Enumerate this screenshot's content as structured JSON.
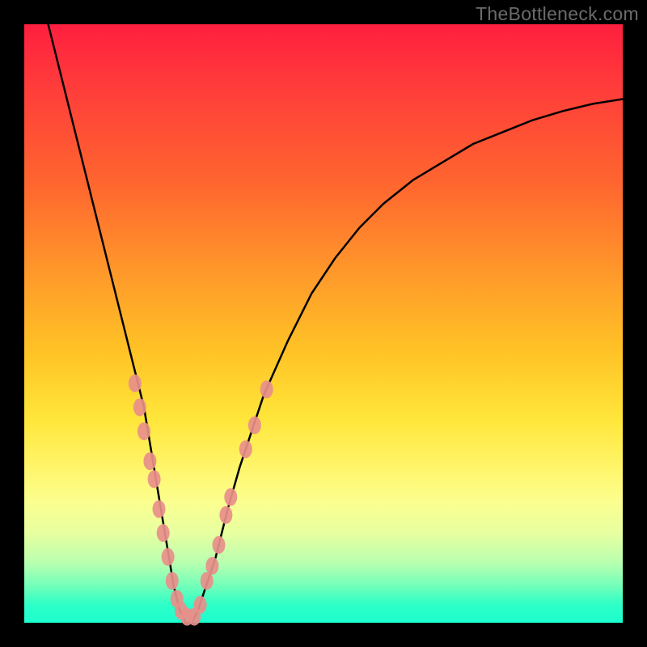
{
  "watermark": "TheBottleneck.com",
  "chart_data": {
    "type": "line",
    "title": "",
    "xlabel": "",
    "ylabel": "",
    "xlim": [
      0,
      100
    ],
    "ylim": [
      0,
      100
    ],
    "series": [
      {
        "name": "curve",
        "x": [
          4,
          6,
          8,
          10,
          12,
          14,
          16,
          18,
          20,
          22,
          23,
          24,
          25,
          26,
          27,
          28,
          29,
          30,
          32,
          34,
          36,
          38,
          40,
          44,
          48,
          52,
          56,
          60,
          65,
          70,
          75,
          80,
          85,
          90,
          95,
          100
        ],
        "y": [
          100,
          92,
          84,
          76,
          68,
          60,
          52,
          44,
          36,
          24,
          18,
          12,
          6,
          2,
          0,
          0,
          2,
          5,
          11,
          19,
          26,
          32,
          38,
          47,
          55,
          61,
          66,
          70,
          74,
          77,
          80,
          82,
          84,
          85.5,
          86.7,
          87.5
        ]
      }
    ],
    "markers": {
      "name": "highlight-points",
      "color": "#e88f8a",
      "points": [
        {
          "x": 18.5,
          "y": 40
        },
        {
          "x": 19.3,
          "y": 36
        },
        {
          "x": 20.0,
          "y": 32
        },
        {
          "x": 21.0,
          "y": 27
        },
        {
          "x": 21.7,
          "y": 24
        },
        {
          "x": 22.5,
          "y": 19
        },
        {
          "x": 23.2,
          "y": 15
        },
        {
          "x": 24.0,
          "y": 11
        },
        {
          "x": 24.7,
          "y": 7
        },
        {
          "x": 25.5,
          "y": 4
        },
        {
          "x": 26.2,
          "y": 2
        },
        {
          "x": 27.2,
          "y": 1
        },
        {
          "x": 28.4,
          "y": 1
        },
        {
          "x": 29.4,
          "y": 3
        },
        {
          "x": 30.5,
          "y": 7
        },
        {
          "x": 31.4,
          "y": 9.5
        },
        {
          "x": 32.5,
          "y": 13
        },
        {
          "x": 33.7,
          "y": 18
        },
        {
          "x": 34.5,
          "y": 21
        },
        {
          "x": 37.0,
          "y": 29
        },
        {
          "x": 38.5,
          "y": 33
        },
        {
          "x": 40.5,
          "y": 39
        }
      ]
    },
    "gradient_stops": [
      {
        "pos": 0,
        "color": "#ff1f3f"
      },
      {
        "pos": 10,
        "color": "#ff3b3b"
      },
      {
        "pos": 28,
        "color": "#ff6a2e"
      },
      {
        "pos": 42,
        "color": "#ff9a2a"
      },
      {
        "pos": 55,
        "color": "#ffc426"
      },
      {
        "pos": 66,
        "color": "#ffe63a"
      },
      {
        "pos": 74,
        "color": "#fff56a"
      },
      {
        "pos": 80,
        "color": "#fbff90"
      },
      {
        "pos": 85,
        "color": "#e8ffa0"
      },
      {
        "pos": 90,
        "color": "#b8ffb0"
      },
      {
        "pos": 94,
        "color": "#6fffb9"
      },
      {
        "pos": 97,
        "color": "#2effc8"
      },
      {
        "pos": 100,
        "color": "#1cffcf"
      }
    ]
  }
}
